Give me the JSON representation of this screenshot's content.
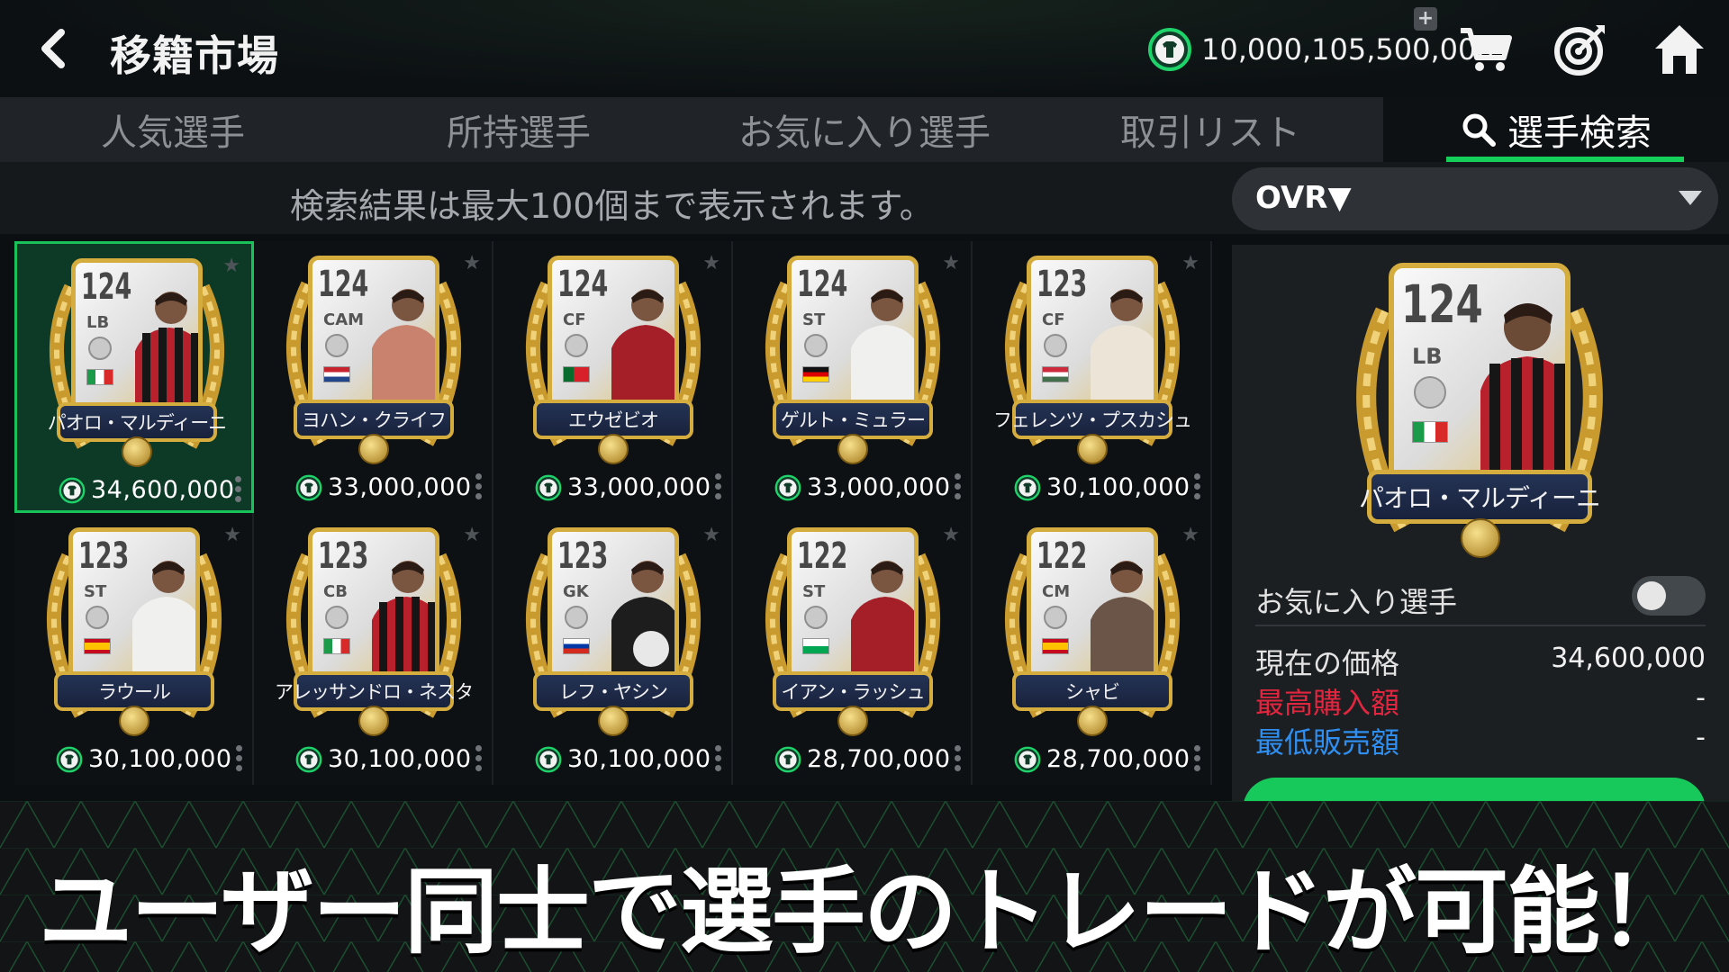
{
  "header": {
    "title": "移籍市場",
    "coins": "10,000,105,500,000",
    "plus": "+"
  },
  "tabs": [
    {
      "label": "人気選手",
      "active": false
    },
    {
      "label": "所持選手",
      "active": false
    },
    {
      "label": "お気に入り選手",
      "active": false
    },
    {
      "label": "取引リスト",
      "active": false
    },
    {
      "label": "選手検索",
      "active": true
    }
  ],
  "info": {
    "notice": "検索結果は最大100個まで表示されます。",
    "sort": "OVR▼"
  },
  "players": [
    {
      "ovr": "124",
      "pos": "LB",
      "name": "パオロ・マルディーニ",
      "price": "34,600,000",
      "flag": "italy",
      "kit": "stripes-rb",
      "selected": true
    },
    {
      "ovr": "124",
      "pos": "CAM",
      "name": "ヨハン・クライフ",
      "price": "33,000,000",
      "flag": "netherlands",
      "kit": "salmon"
    },
    {
      "ovr": "124",
      "pos": "CF",
      "name": "エウゼビオ",
      "price": "33,000,000",
      "flag": "portugal",
      "kit": "red"
    },
    {
      "ovr": "124",
      "pos": "ST",
      "name": "ゲルト・ミュラー",
      "price": "33,000,000",
      "flag": "germany",
      "kit": "white"
    },
    {
      "ovr": "123",
      "pos": "CF",
      "name": "フェレンツ・プスカシュ",
      "price": "30,100,000",
      "flag": "hungary",
      "kit": "cream"
    },
    {
      "ovr": "123",
      "pos": "ST",
      "name": "ラウール",
      "price": "30,100,000",
      "flag": "spain",
      "kit": "white"
    },
    {
      "ovr": "123",
      "pos": "CB",
      "name": "アレッサンドロ・ネスタ",
      "price": "30,100,000",
      "flag": "italy",
      "kit": "stripes-rb"
    },
    {
      "ovr": "123",
      "pos": "GK",
      "name": "レフ・ヤシン",
      "price": "30,100,000",
      "flag": "russia",
      "kit": "black"
    },
    {
      "ovr": "122",
      "pos": "ST",
      "name": "イアン・ラッシュ",
      "price": "28,700,000",
      "flag": "wales",
      "kit": "red"
    },
    {
      "ovr": "122",
      "pos": "CM",
      "name": "シャビ",
      "price": "28,700,000",
      "flag": "spain",
      "kit": "brown"
    }
  ],
  "detail": {
    "ovr": "124",
    "pos": "LB",
    "name": "パオロ・マルディーニ",
    "favorite_label": "お気に入り選手",
    "current_price_label": "現在の価格",
    "current_price": "34,600,000",
    "max_buy_label": "最高購入額",
    "max_buy": "-",
    "min_sell_label": "最低販売額",
    "min_sell": "-"
  },
  "banner": {
    "text": "ユーザー同士で選手のトレードが可能！"
  },
  "colors": {
    "accent_green": "#14d05a",
    "max_buy_red": "#e2263f",
    "min_sell_blue": "#2f8ff0"
  },
  "icons": [
    "back-arrow-icon",
    "coin-icon",
    "cart-icon",
    "target-icon",
    "home-icon",
    "search-icon",
    "star-icon",
    "more-dots-icon"
  ]
}
